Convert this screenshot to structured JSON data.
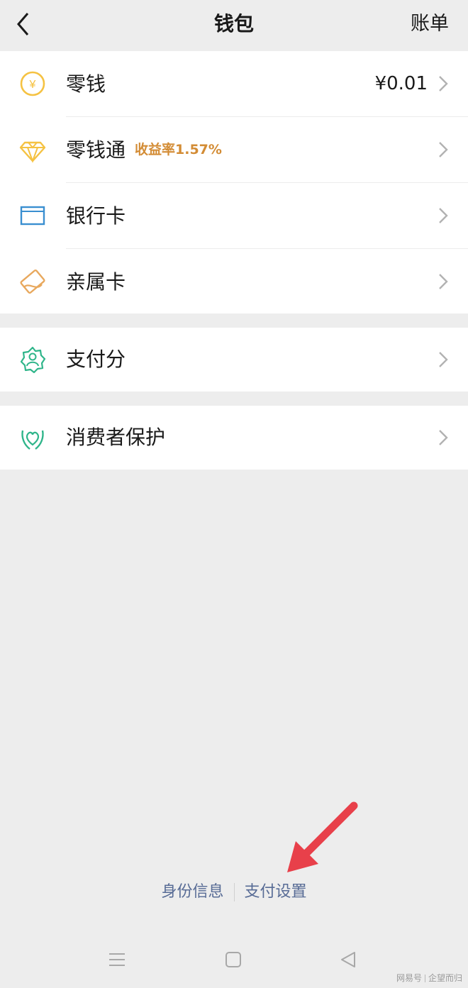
{
  "header": {
    "back_icon": "chevron-left-icon",
    "title": "钱包",
    "bill_label": "账单"
  },
  "groups": {
    "main": [
      {
        "id": "change",
        "icon": "yuan-coin-icon",
        "icon_color": "#f5c242",
        "label": "零钱",
        "value": "¥0.01"
      },
      {
        "id": "lingqiantong",
        "icon": "diamond-icon",
        "icon_color": "#f5c242",
        "label": "零钱通",
        "sub": "收益率1.57%",
        "sub_color": "#d38c35"
      },
      {
        "id": "bank-card",
        "icon": "card-icon",
        "icon_color": "#3a8fd0",
        "label": "银行卡"
      },
      {
        "id": "family-card",
        "icon": "family-card-icon",
        "icon_color": "#e8a85d",
        "label": "亲属卡"
      }
    ],
    "score": [
      {
        "id": "pay-score",
        "icon": "badge-person-icon",
        "icon_color": "#2fb58a",
        "label": "支付分"
      }
    ],
    "protect": [
      {
        "id": "consumer-protection",
        "icon": "hands-heart-icon",
        "icon_color": "#2fb58a",
        "label": "消费者保护"
      }
    ]
  },
  "bottom_links": {
    "identity": "身份信息",
    "pay_settings": "支付设置",
    "link_color": "#576b95"
  },
  "annotation": {
    "arrow_color": "#e8404a"
  },
  "watermark": {
    "left": "网易号",
    "right": "企望而归"
  }
}
